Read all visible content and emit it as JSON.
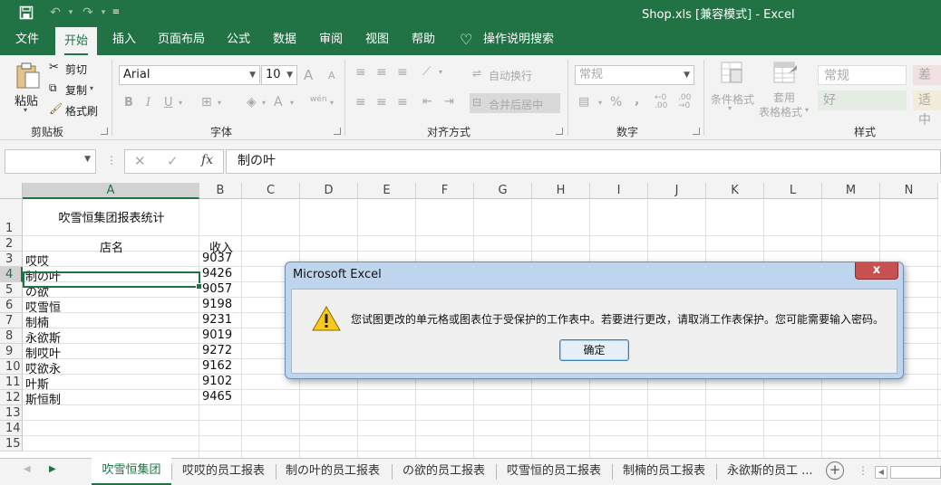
{
  "window": {
    "title": "Shop.xls  [兼容模式]  -  Excel"
  },
  "ribbon_tabs": [
    "文件",
    "开始",
    "插入",
    "页面布局",
    "公式",
    "数据",
    "审阅",
    "视图",
    "帮助",
    "操作说明搜索"
  ],
  "active_tab": "开始",
  "clipboard": {
    "paste": "粘贴",
    "cut": "剪切",
    "copy": "复制",
    "format_painter": "格式刷",
    "group_label": "剪贴板"
  },
  "font": {
    "name": "Arial",
    "size": "10",
    "group_label": "字体",
    "bold": "B",
    "italic": "I",
    "underline": "U",
    "grow": "A",
    "shrink": "A",
    "color_a": "A",
    "phonetic": "wén"
  },
  "alignment": {
    "wrap_text": "自动换行",
    "merge_center": "合并后居中",
    "group_label": "对齐方式"
  },
  "number": {
    "format": "常规",
    "percent": "%",
    "comma": ",",
    "group_label": "数字"
  },
  "styles": {
    "conditional_formatting": "条件格式",
    "format_as_table_1": "套用",
    "format_as_table_2": "表格格式",
    "normal": "常规",
    "bad": "差",
    "good": "好",
    "neutral": "适中",
    "group_label": "样式"
  },
  "formula_bar": {
    "name_box": "",
    "content": "制の叶"
  },
  "columns": [
    "A",
    "B",
    "C",
    "D",
    "E",
    "F",
    "G",
    "H",
    "I",
    "J",
    "K",
    "L",
    "M",
    "N"
  ],
  "rows": [
    "1",
    "2",
    "3",
    "4",
    "5",
    "6",
    "7",
    "8",
    "9",
    "10",
    "11",
    "12",
    "13",
    "14",
    "15"
  ],
  "sheet": {
    "title": "吹雪恒集团报表统计",
    "header_name": "店名",
    "header_income": "收入",
    "records": [
      {
        "name": "哎哎",
        "income": "9037"
      },
      {
        "name": "制の叶",
        "income": "9426"
      },
      {
        "name": "の欲",
        "income": "9057"
      },
      {
        "name": "哎雪恒",
        "income": "9198"
      },
      {
        "name": "制楠",
        "income": "9231"
      },
      {
        "name": "永欲斯",
        "income": "9019"
      },
      {
        "name": "制哎叶",
        "income": "9272"
      },
      {
        "name": "哎欲永",
        "income": "9162"
      },
      {
        "name": "叶斯",
        "income": "9102"
      },
      {
        "name": "斯恒制",
        "income": "9465"
      }
    ]
  },
  "sheet_tabs": [
    "吹雪恒集团",
    "哎哎的员工报表",
    "制の叶的员工报表",
    "の欲的员工报表",
    "哎雪恒的员工报表",
    "制楠的员工报表",
    "永欲斯的员工 ..."
  ],
  "dialog": {
    "title": "Microsoft Excel",
    "close": "x",
    "message": "您试图更改的单元格或图表位于受保护的工作表中。若要进行更改，请取消工作表保护。您可能需要输入密码。",
    "ok": "确定"
  },
  "colors": {
    "brand": "#217346",
    "ribbon_bg": "#f3f3f3",
    "dialog_frame": "#bfd5ee"
  }
}
